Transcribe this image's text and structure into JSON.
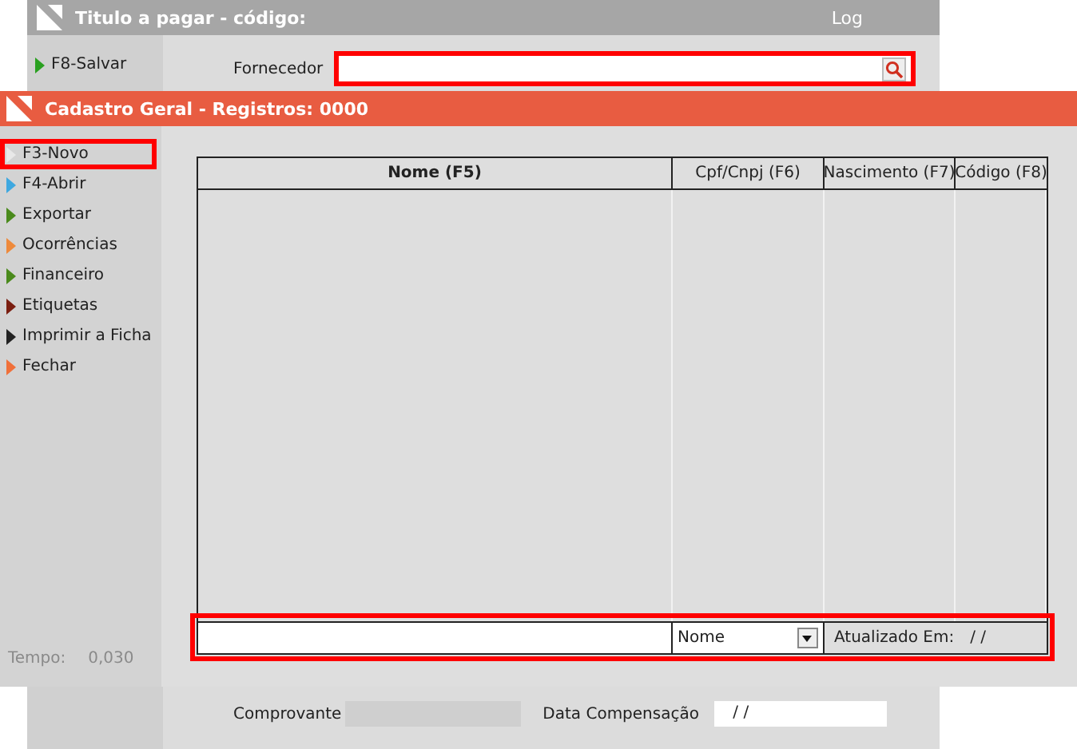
{
  "back_window": {
    "title": "Titulo a pagar - código:",
    "log_label": "Log",
    "sidebar_items": [
      "F8-Salvar"
    ],
    "supplier": {
      "label": "Fornecedor",
      "highlighted": true
    },
    "receipt_label": "Comprovante",
    "clearing_date": {
      "label": "Data Compensação",
      "value": "/ /"
    }
  },
  "window": {
    "title": "Cadastro Geral - Registros: 0000"
  },
  "sidebar": {
    "items": [
      {
        "label": "F3-Novo",
        "color": "#e8e8e8",
        "highlighted": true
      },
      {
        "label": "F4-Abrir",
        "color": "#3ea8e0",
        "highlighted": false
      },
      {
        "label": "Exportar",
        "color": "#4a8a1c",
        "highlighted": false
      },
      {
        "label": "Ocorrências",
        "color": "#ee8a3c",
        "highlighted": false
      },
      {
        "label": "Financeiro",
        "color": "#4a8a1c",
        "highlighted": false
      },
      {
        "label": "Etiquetas",
        "color": "#7a1e10",
        "highlighted": false
      },
      {
        "label": "Imprimir a Ficha",
        "color": "#222222",
        "highlighted": false
      },
      {
        "label": "Fechar",
        "color": "#f0703a",
        "highlighted": false
      }
    ],
    "timer": {
      "label": "Tempo:",
      "value": "0,030"
    }
  },
  "table": {
    "columns": [
      {
        "label": "Nome (F5)",
        "sorted": true
      },
      {
        "label": "Cpf/Cnpj (F6)",
        "sorted": false
      },
      {
        "label": "Nascimento (F7)",
        "sorted": false
      },
      {
        "label": "Código (F8)",
        "sorted": false
      }
    ]
  },
  "search_bar": {
    "highlighted": true,
    "field_selected": "Nome",
    "updated_label": "Atualizado Em:",
    "updated_value": "/ /"
  }
}
